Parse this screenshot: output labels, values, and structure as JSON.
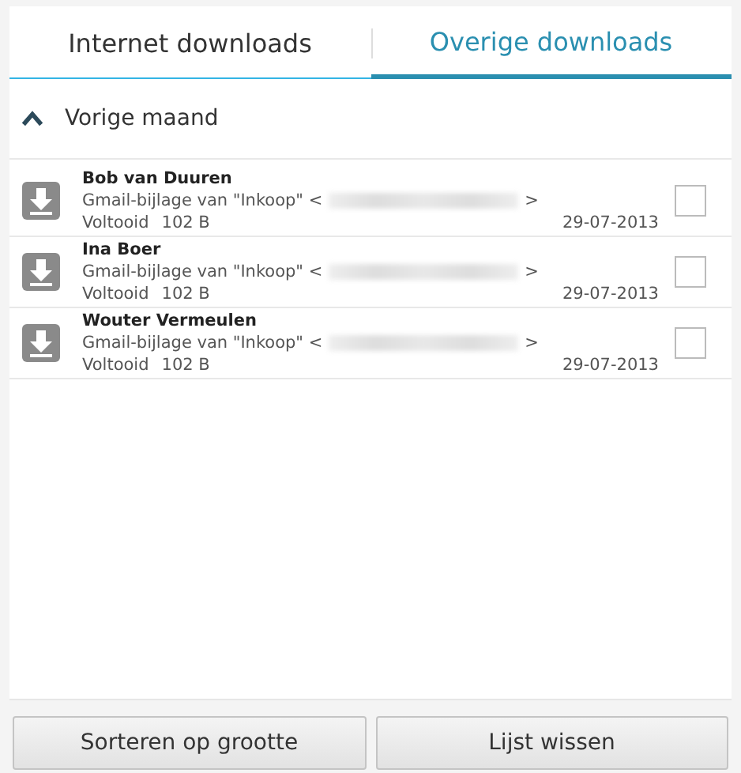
{
  "tabs": [
    {
      "label": "Internet downloads",
      "selected": false
    },
    {
      "label": "Overige downloads",
      "selected": true
    }
  ],
  "section": {
    "title": "Vorige maand",
    "expanded": true
  },
  "downloads": [
    {
      "name": "Bob van Duuren",
      "description": "Gmail-bijlage van \"Inkoop\" <",
      "description_end": ">",
      "status": "Voltooid",
      "size": "102 B",
      "date": "29-07-2013",
      "checked": false
    },
    {
      "name": "Ina Boer",
      "description": "Gmail-bijlage van \"Inkoop\" <",
      "description_end": ">",
      "status": "Voltooid",
      "size": "102 B",
      "date": "29-07-2013",
      "checked": false
    },
    {
      "name": "Wouter Vermeulen",
      "description": "Gmail-bijlage van \"Inkoop\" <",
      "description_end": ">",
      "status": "Voltooid",
      "size": "102 B",
      "date": "29-07-2013",
      "checked": false
    }
  ],
  "buttons": [
    "Sorteren op grootte",
    "Lijst wissen"
  ]
}
